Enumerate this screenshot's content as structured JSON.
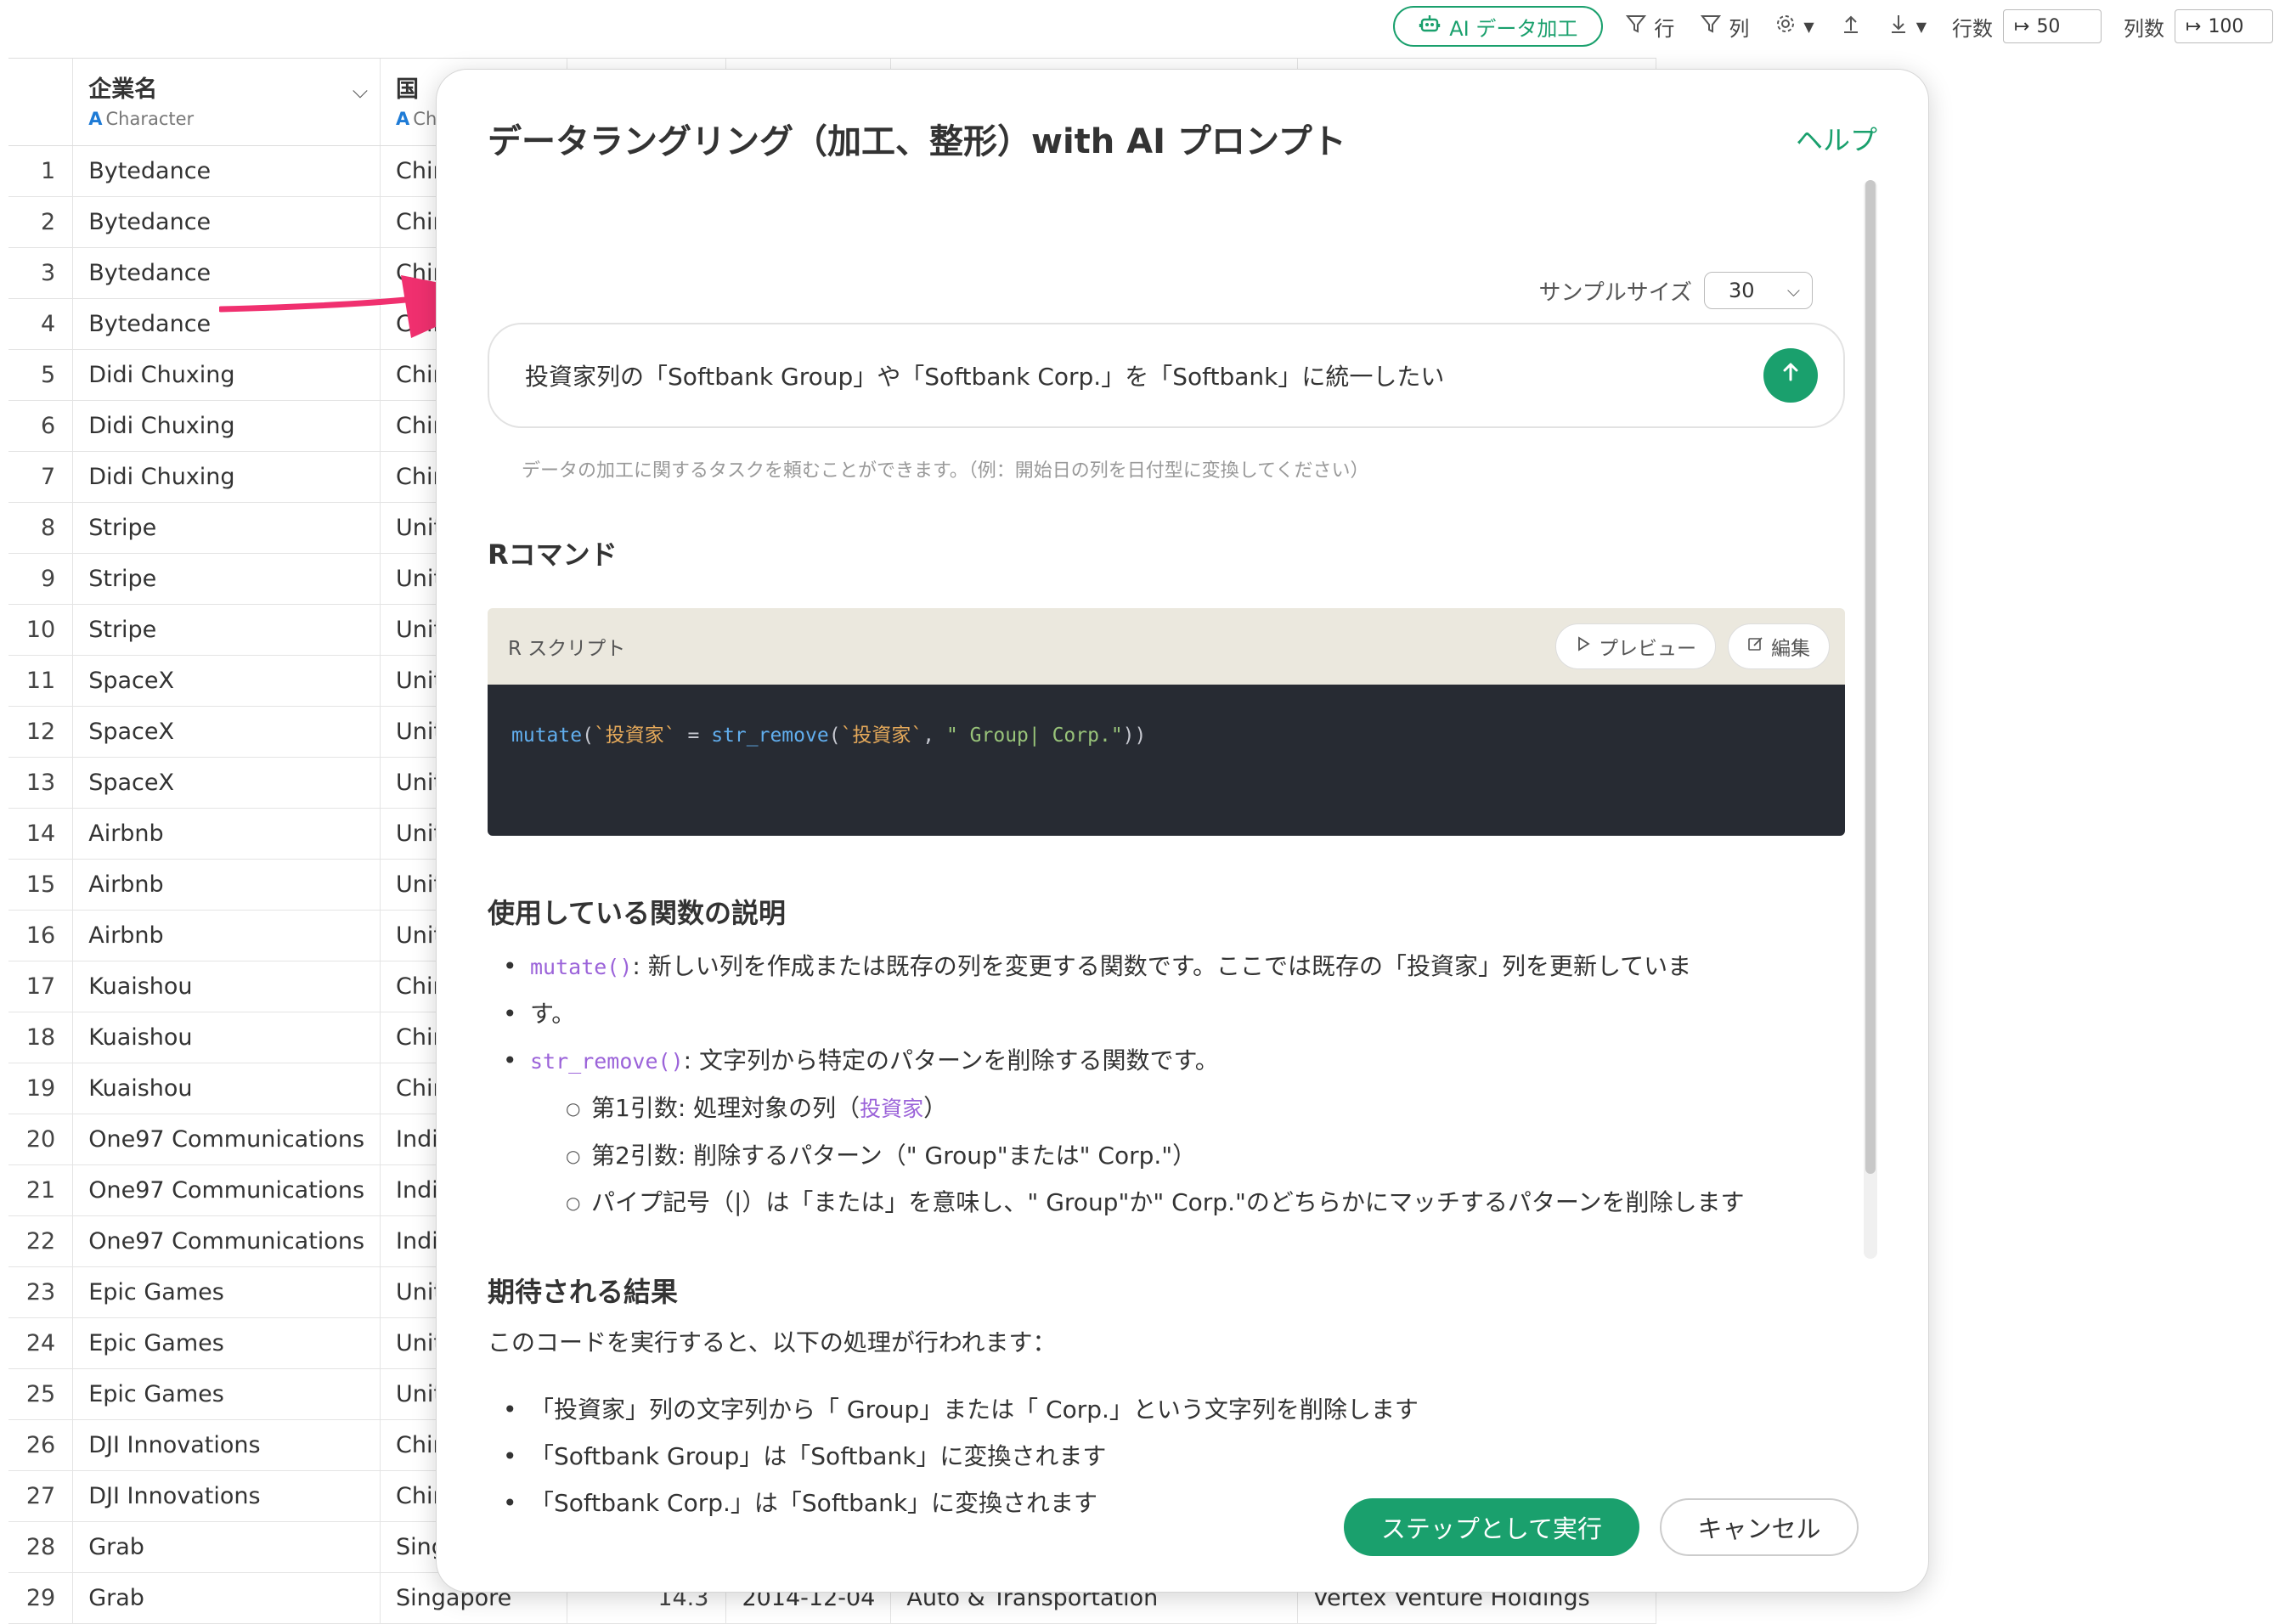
{
  "toolbar": {
    "ai_button": "AI データ加工",
    "row_filter": "行",
    "col_filter": "列",
    "rows_label": "行数",
    "rows_value": "50",
    "cols_label": "列数",
    "cols_value": "100"
  },
  "grid": {
    "columns": [
      {
        "name": "企業名",
        "type_icon": "A",
        "type": "Character"
      },
      {
        "name": "国",
        "type_icon": "A",
        "type": "Character"
      }
    ],
    "rows": [
      {
        "n": "1",
        "company": "Bytedance",
        "country": "China"
      },
      {
        "n": "2",
        "company": "Bytedance",
        "country": "China"
      },
      {
        "n": "3",
        "company": "Bytedance",
        "country": "China"
      },
      {
        "n": "4",
        "company": "Bytedance",
        "country": "China"
      },
      {
        "n": "5",
        "company": "Didi Chuxing",
        "country": "China"
      },
      {
        "n": "6",
        "company": "Didi Chuxing",
        "country": "China"
      },
      {
        "n": "7",
        "company": "Didi Chuxing",
        "country": "China"
      },
      {
        "n": "8",
        "company": "Stripe",
        "country": "United States"
      },
      {
        "n": "9",
        "company": "Stripe",
        "country": "United States"
      },
      {
        "n": "10",
        "company": "Stripe",
        "country": "United States"
      },
      {
        "n": "11",
        "company": "SpaceX",
        "country": "United States"
      },
      {
        "n": "12",
        "company": "SpaceX",
        "country": "United States"
      },
      {
        "n": "13",
        "company": "SpaceX",
        "country": "United States"
      },
      {
        "n": "14",
        "company": "Airbnb",
        "country": "United States"
      },
      {
        "n": "15",
        "company": "Airbnb",
        "country": "United States"
      },
      {
        "n": "16",
        "company": "Airbnb",
        "country": "United States"
      },
      {
        "n": "17",
        "company": "Kuaishou",
        "country": "China"
      },
      {
        "n": "18",
        "company": "Kuaishou",
        "country": "China"
      },
      {
        "n": "19",
        "company": "Kuaishou",
        "country": "China"
      },
      {
        "n": "20",
        "company": "One97 Communications",
        "country": "India"
      },
      {
        "n": "21",
        "company": "One97 Communications",
        "country": "India"
      },
      {
        "n": "22",
        "company": "One97 Communications",
        "country": "India"
      },
      {
        "n": "23",
        "company": "Epic Games",
        "country": "United States"
      },
      {
        "n": "24",
        "company": "Epic Games",
        "country": "United States"
      },
      {
        "n": "25",
        "company": "Epic Games",
        "country": "United States"
      },
      {
        "n": "26",
        "company": "DJI Innovations",
        "country": "China"
      },
      {
        "n": "27",
        "company": "DJI Innovations",
        "country": "China"
      },
      {
        "n": "28",
        "company": "Grab",
        "country": "Singapore"
      }
    ],
    "last_row": {
      "n": "29",
      "company": "Grab",
      "country": "Singapore",
      "value": "14.3",
      "date": "2014-12-04",
      "industry": "Auto & Transportation",
      "investor": "Vertex Venture Holdings"
    }
  },
  "modal": {
    "title": "データラングリング（加工、整形）with AI プロンプト",
    "help": "ヘルプ",
    "sample_label": "サンプルサイズ",
    "sample_value": "30",
    "prompt_text": "投資家列の「Softbank Group」や「Softbank Corp.」を「Softbank」に統一したい",
    "hint": "データの加工に関するタスクを頼むことができます。（例：開始日の列を日付型に変換してください）",
    "r_command_heading": "Rコマンド",
    "script_label": "R スクリプト",
    "preview_button": "プレビュー",
    "edit_button": "編集",
    "code": {
      "fn1": "mutate",
      "p1": "(",
      "id1": "`投資家`",
      "eq": " = ",
      "fn2": "str_remove",
      "p2": "(",
      "id2": "`投資家`",
      "comma": ", ",
      "str": "\" Group| Corp.\"",
      "close": "))"
    },
    "func_heading": "使用している関数の説明",
    "func_items": {
      "mutate_fn": "mutate()",
      "mutate_desc": ": 新しい列を作成または既存の列を変更する関数です。ここでは既存の「投資家」列を更新していま",
      "mutate_desc2": "す。",
      "strrm_fn": "str_remove()",
      "strrm_desc": ": 文字列から特定のパターンを削除する関数です。",
      "arg1_label": "第1引数: 処理対象の列（",
      "arg1_code": "投資家",
      "arg1_close": "）",
      "arg2": "第2引数: 削除するパターン（\" Group\"または\" Corp.\"）",
      "pipe": "パイプ記号（|）は「または」を意味し、\" Group\"か\" Corp.\"のどちらかにマッチするパターンを削除します"
    },
    "result_heading": "期待される結果",
    "result_intro": "このコードを実行すると、以下の処理が行われます：",
    "results": [
      "「投資家」列の文字列から「 Group」または「 Corp.」という文字列を削除します",
      "「Softbank Group」は「Softbank」に変換されます",
      "「Softbank Corp.」は「Softbank」に変換されます"
    ],
    "run_button": "ステップとして実行",
    "cancel_button": "キャンセル"
  },
  "colors": {
    "accent": "#1aa06d",
    "arrow": "#f0306f",
    "code_bg": "#272b33",
    "code_header_bg": "#ebe8de"
  }
}
